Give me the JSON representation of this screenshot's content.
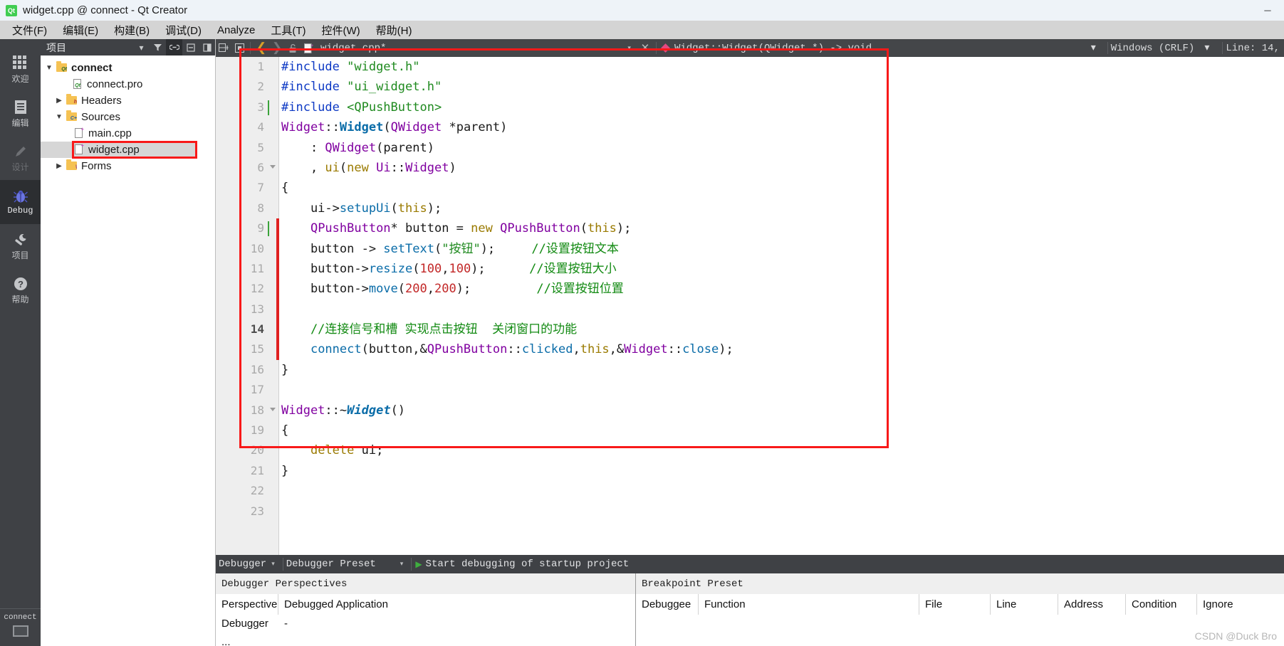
{
  "window": {
    "title": "widget.cpp @ connect - Qt Creator",
    "logo_icon": "qt-logo-icon",
    "minimize_label": "─",
    "maximize_label": "□",
    "close_label": "✕"
  },
  "menubar": {
    "items": [
      {
        "label": "文件(F)",
        "name": "menu-file"
      },
      {
        "label": "编辑(E)",
        "name": "menu-edit"
      },
      {
        "label": "构建(B)",
        "name": "menu-build"
      },
      {
        "label": "调试(D)",
        "name": "menu-debug"
      },
      {
        "label": "Analyze",
        "name": "menu-analyze"
      },
      {
        "label": "工具(T)",
        "name": "menu-tools"
      },
      {
        "label": "控件(W)",
        "name": "menu-widgets"
      },
      {
        "label": "帮助(H)",
        "name": "menu-help"
      }
    ]
  },
  "modebar": {
    "modes": [
      {
        "label": "欢迎",
        "icon": "grid-icon",
        "state": "normal",
        "name": "mode-welcome"
      },
      {
        "label": "编辑",
        "icon": "document-icon",
        "state": "normal",
        "name": "mode-edit"
      },
      {
        "label": "设计",
        "icon": "pencil-icon",
        "state": "disabled",
        "name": "mode-design"
      },
      {
        "label": "Debug",
        "icon": "bug-icon",
        "state": "active",
        "name": "mode-debug"
      },
      {
        "label": "项目",
        "icon": "wrench-icon",
        "state": "normal",
        "name": "mode-projects"
      },
      {
        "label": "帮助",
        "icon": "help-icon",
        "state": "normal",
        "name": "mode-help"
      }
    ],
    "kit_chip": "connect"
  },
  "project_pane": {
    "header_title": "项目",
    "header_buttons": [
      {
        "icon": "chevron-down-icon",
        "name": "project-filter-dropdown"
      },
      {
        "icon": "filter-icon",
        "name": "project-filter-button"
      },
      {
        "icon": "link-icon",
        "name": "sync-with-editor-toggle",
        "active": true
      },
      {
        "icon": "collapse-all-icon",
        "name": "collapse-all-button"
      },
      {
        "icon": "split-icon",
        "name": "split-button"
      }
    ],
    "tree": [
      {
        "label": "connect",
        "icon": "qt-project-folder-icon",
        "depth": 0,
        "arrow": "expanded",
        "bold": true,
        "name": "tree-item-connect"
      },
      {
        "label": "connect.pro",
        "icon": "pro-file-icon",
        "depth": 1,
        "arrow": "none",
        "bold": false,
        "name": "tree-item-connect-pro"
      },
      {
        "label": "Headers",
        "icon": "headers-folder-icon",
        "depth": 1,
        "arrow": "collapsed",
        "bold": false,
        "name": "tree-item-headers"
      },
      {
        "label": "Sources",
        "icon": "sources-folder-icon",
        "depth": 1,
        "arrow": "expanded",
        "bold": false,
        "name": "tree-item-sources"
      },
      {
        "label": "main.cpp",
        "icon": "cpp-file-icon",
        "depth": 2,
        "arrow": "none",
        "bold": false,
        "name": "tree-item-main-cpp"
      },
      {
        "label": "widget.cpp",
        "icon": "cpp-file-icon",
        "depth": 2,
        "arrow": "none",
        "bold": false,
        "selected": true,
        "highlighted": true,
        "name": "tree-item-widget-cpp"
      },
      {
        "label": "Forms",
        "icon": "forms-folder-icon",
        "depth": 1,
        "arrow": "collapsed",
        "bold": false,
        "name": "tree-item-forms"
      }
    ]
  },
  "editor_toolbar": {
    "icons": [
      {
        "icon": "split-horizontal-icon",
        "name": "split-editor-button"
      },
      {
        "icon": "close-split-icon",
        "name": "close-split-button"
      },
      {
        "icon": "back-arrow-icon",
        "name": "go-back-button"
      },
      {
        "icon": "forward-arrow-icon",
        "name": "go-forward-button"
      },
      {
        "icon": "unlock-icon",
        "name": "toggle-readonly-button"
      },
      {
        "icon": "cpp-file-icon",
        "name": "current-file-icon"
      }
    ],
    "file_name": "widget.cpp*",
    "file_dropdown_arrow": "▾",
    "close_label": "✕",
    "symbol_icon": "method-diamond-icon",
    "symbol_name": "Widget::Widget(QWidget *) -> void",
    "symbol_dropdown_arrow": "▾",
    "line_ending": "Windows (CRLF)",
    "line_ending_arrow": "▾",
    "cursor_position": "Line: 14,"
  },
  "editor": {
    "lines": [
      {
        "num": "1",
        "current": false,
        "fold": false,
        "green": false,
        "change": false,
        "tokens": [
          {
            "t": "#include ",
            "c": "t-pp"
          },
          {
            "t": "\"widget.h\"",
            "c": "t-str"
          }
        ]
      },
      {
        "num": "2",
        "current": false,
        "fold": false,
        "green": false,
        "change": false,
        "tokens": [
          {
            "t": "#include ",
            "c": "t-pp"
          },
          {
            "t": "\"ui_widget.h\"",
            "c": "t-str"
          }
        ]
      },
      {
        "num": "3",
        "current": false,
        "fold": false,
        "green": true,
        "change": false,
        "tokens": [
          {
            "t": "#include ",
            "c": "t-pp"
          },
          {
            "t": "<QPushButton>",
            "c": "t-inc"
          }
        ]
      },
      {
        "num": "4",
        "current": false,
        "fold": false,
        "green": false,
        "change": false,
        "tokens": [
          {
            "t": "Widget",
            "c": "t-type"
          },
          {
            "t": "::",
            "c": "t-punc"
          },
          {
            "t": "Widget",
            "c": "t-fnb"
          },
          {
            "t": "(",
            "c": "t-punc"
          },
          {
            "t": "QWidget",
            "c": "t-type"
          },
          {
            "t": " *parent)",
            "c": "t-pl"
          }
        ]
      },
      {
        "num": "5",
        "current": false,
        "fold": false,
        "green": false,
        "change": false,
        "tokens": [
          {
            "t": "    : ",
            "c": "t-pl"
          },
          {
            "t": "QWidget",
            "c": "t-type"
          },
          {
            "t": "(parent)",
            "c": "t-pl"
          }
        ]
      },
      {
        "num": "6",
        "current": false,
        "fold": true,
        "green": false,
        "change": false,
        "tokens": [
          {
            "t": "    , ",
            "c": "t-pl"
          },
          {
            "t": "ui",
            "c": "t-kw"
          },
          {
            "t": "(",
            "c": "t-punc"
          },
          {
            "t": "new ",
            "c": "t-kw"
          },
          {
            "t": "Ui",
            "c": "t-type"
          },
          {
            "t": "::",
            "c": "t-punc"
          },
          {
            "t": "Widget",
            "c": "t-type"
          },
          {
            "t": ")",
            "c": "t-punc"
          }
        ]
      },
      {
        "num": "7",
        "current": false,
        "fold": false,
        "green": false,
        "change": false,
        "tokens": [
          {
            "t": "{",
            "c": "t-pl"
          }
        ]
      },
      {
        "num": "8",
        "current": false,
        "fold": false,
        "green": false,
        "change": false,
        "tokens": [
          {
            "t": "    ui->",
            "c": "t-pl"
          },
          {
            "t": "setupUi",
            "c": "t-fn"
          },
          {
            "t": "(",
            "c": "t-punc"
          },
          {
            "t": "this",
            "c": "t-kw"
          },
          {
            "t": ");",
            "c": "t-punc"
          }
        ]
      },
      {
        "num": "9",
        "current": false,
        "fold": false,
        "green": true,
        "change": true,
        "tokens": [
          {
            "t": "    ",
            "c": "t-pl"
          },
          {
            "t": "QPushButton",
            "c": "t-type"
          },
          {
            "t": "* button = ",
            "c": "t-pl"
          },
          {
            "t": "new ",
            "c": "t-kw"
          },
          {
            "t": "QPushButton",
            "c": "t-type"
          },
          {
            "t": "(",
            "c": "t-punc"
          },
          {
            "t": "this",
            "c": "t-kw"
          },
          {
            "t": ");",
            "c": "t-punc"
          }
        ]
      },
      {
        "num": "10",
        "current": false,
        "fold": false,
        "green": false,
        "change": true,
        "tokens": [
          {
            "t": "    button -> ",
            "c": "t-pl"
          },
          {
            "t": "setText",
            "c": "t-fn"
          },
          {
            "t": "(",
            "c": "t-punc"
          },
          {
            "t": "\"按钮\"",
            "c": "t-str"
          },
          {
            "t": ");",
            "c": "t-punc"
          },
          {
            "t": "     ",
            "c": "t-pl"
          },
          {
            "t": "//设置按钮文本",
            "c": "t-cmt"
          }
        ]
      },
      {
        "num": "11",
        "current": false,
        "fold": false,
        "green": false,
        "change": true,
        "tokens": [
          {
            "t": "    button->",
            "c": "t-pl"
          },
          {
            "t": "resize",
            "c": "t-fn"
          },
          {
            "t": "(",
            "c": "t-punc"
          },
          {
            "t": "100",
            "c": "t-num"
          },
          {
            "t": ",",
            "c": "t-punc"
          },
          {
            "t": "100",
            "c": "t-num"
          },
          {
            "t": ");",
            "c": "t-punc"
          },
          {
            "t": "      ",
            "c": "t-pl"
          },
          {
            "t": "//设置按钮大小",
            "c": "t-cmt"
          }
        ]
      },
      {
        "num": "12",
        "current": false,
        "fold": false,
        "green": false,
        "change": true,
        "tokens": [
          {
            "t": "    button->",
            "c": "t-pl"
          },
          {
            "t": "move",
            "c": "t-fn"
          },
          {
            "t": "(",
            "c": "t-punc"
          },
          {
            "t": "200",
            "c": "t-num"
          },
          {
            "t": ",",
            "c": "t-punc"
          },
          {
            "t": "200",
            "c": "t-num"
          },
          {
            "t": ");",
            "c": "t-punc"
          },
          {
            "t": "         ",
            "c": "t-pl"
          },
          {
            "t": "//设置按钮位置",
            "c": "t-cmt"
          }
        ]
      },
      {
        "num": "13",
        "current": false,
        "fold": false,
        "green": false,
        "change": true,
        "tokens": []
      },
      {
        "num": "14",
        "current": true,
        "fold": false,
        "green": false,
        "change": true,
        "tokens": [
          {
            "t": "    //连接信号和槽 实现点击按钮  关闭窗口的功能",
            "c": "t-cmt"
          }
        ]
      },
      {
        "num": "15",
        "current": false,
        "fold": false,
        "green": false,
        "change": true,
        "tokens": [
          {
            "t": "    ",
            "c": "t-pl"
          },
          {
            "t": "connect",
            "c": "t-fn"
          },
          {
            "t": "(button,&",
            "c": "t-pl"
          },
          {
            "t": "QPushButton",
            "c": "t-type"
          },
          {
            "t": "::",
            "c": "t-punc"
          },
          {
            "t": "clicked",
            "c": "t-fn"
          },
          {
            "t": ",",
            "c": "t-punc"
          },
          {
            "t": "this",
            "c": "t-kw"
          },
          {
            "t": ",&",
            "c": "t-pl"
          },
          {
            "t": "Widget",
            "c": "t-type"
          },
          {
            "t": "::",
            "c": "t-punc"
          },
          {
            "t": "close",
            "c": "t-fn"
          },
          {
            "t": ");",
            "c": "t-punc"
          }
        ]
      },
      {
        "num": "16",
        "current": false,
        "fold": false,
        "green": false,
        "change": false,
        "tokens": [
          {
            "t": "}",
            "c": "t-pl"
          }
        ]
      },
      {
        "num": "17",
        "current": false,
        "fold": false,
        "green": false,
        "change": false,
        "tokens": []
      },
      {
        "num": "18",
        "current": false,
        "fold": true,
        "green": false,
        "change": false,
        "tokens": [
          {
            "t": "Widget",
            "c": "t-type"
          },
          {
            "t": "::~",
            "c": "t-punc"
          },
          {
            "t": "Widget",
            "c": "t-dtor"
          },
          {
            "t": "()",
            "c": "t-punc"
          }
        ]
      },
      {
        "num": "19",
        "current": false,
        "fold": false,
        "green": false,
        "change": false,
        "tokens": [
          {
            "t": "{",
            "c": "t-pl"
          }
        ]
      },
      {
        "num": "20",
        "current": false,
        "fold": false,
        "green": false,
        "change": false,
        "tokens": [
          {
            "t": "    ",
            "c": "t-pl"
          },
          {
            "t": "delete",
            "c": "t-kw"
          },
          {
            "t": " ui;",
            "c": "t-pl"
          }
        ]
      },
      {
        "num": "21",
        "current": false,
        "fold": false,
        "green": false,
        "change": false,
        "tokens": [
          {
            "t": "}",
            "c": "t-pl"
          }
        ]
      },
      {
        "num": "22",
        "current": false,
        "fold": false,
        "green": false,
        "change": false,
        "tokens": []
      },
      {
        "num": "23",
        "current": false,
        "fold": false,
        "green": false,
        "change": false,
        "tokens": []
      }
    ]
  },
  "debugger_bar": {
    "mode_label": "Debugger",
    "mode_arrow": "▾",
    "preset_label": "Debugger Preset",
    "preset_arrow": "▾",
    "run_icon": "start-debugging-icon",
    "action_label": "Start debugging of startup project"
  },
  "debugger_panel": {
    "left": {
      "title": "Debugger Perspectives",
      "columns": [
        "Perspective",
        "Debugged Application"
      ],
      "rows": [
        [
          "Debugger ...",
          "-"
        ]
      ]
    },
    "right": {
      "title": "Breakpoint Preset",
      "columns": [
        "Debuggee",
        "Function",
        "File",
        "Line",
        "Address",
        "Condition",
        "Ignore"
      ],
      "rows": []
    }
  },
  "watermark": "CSDN @Duck Bro",
  "colors": {
    "accent_red": "#f81919",
    "modebar_bg": "#3f4145",
    "toolbar_bg": "#444649",
    "selection_bg": "#d6d6d6"
  }
}
